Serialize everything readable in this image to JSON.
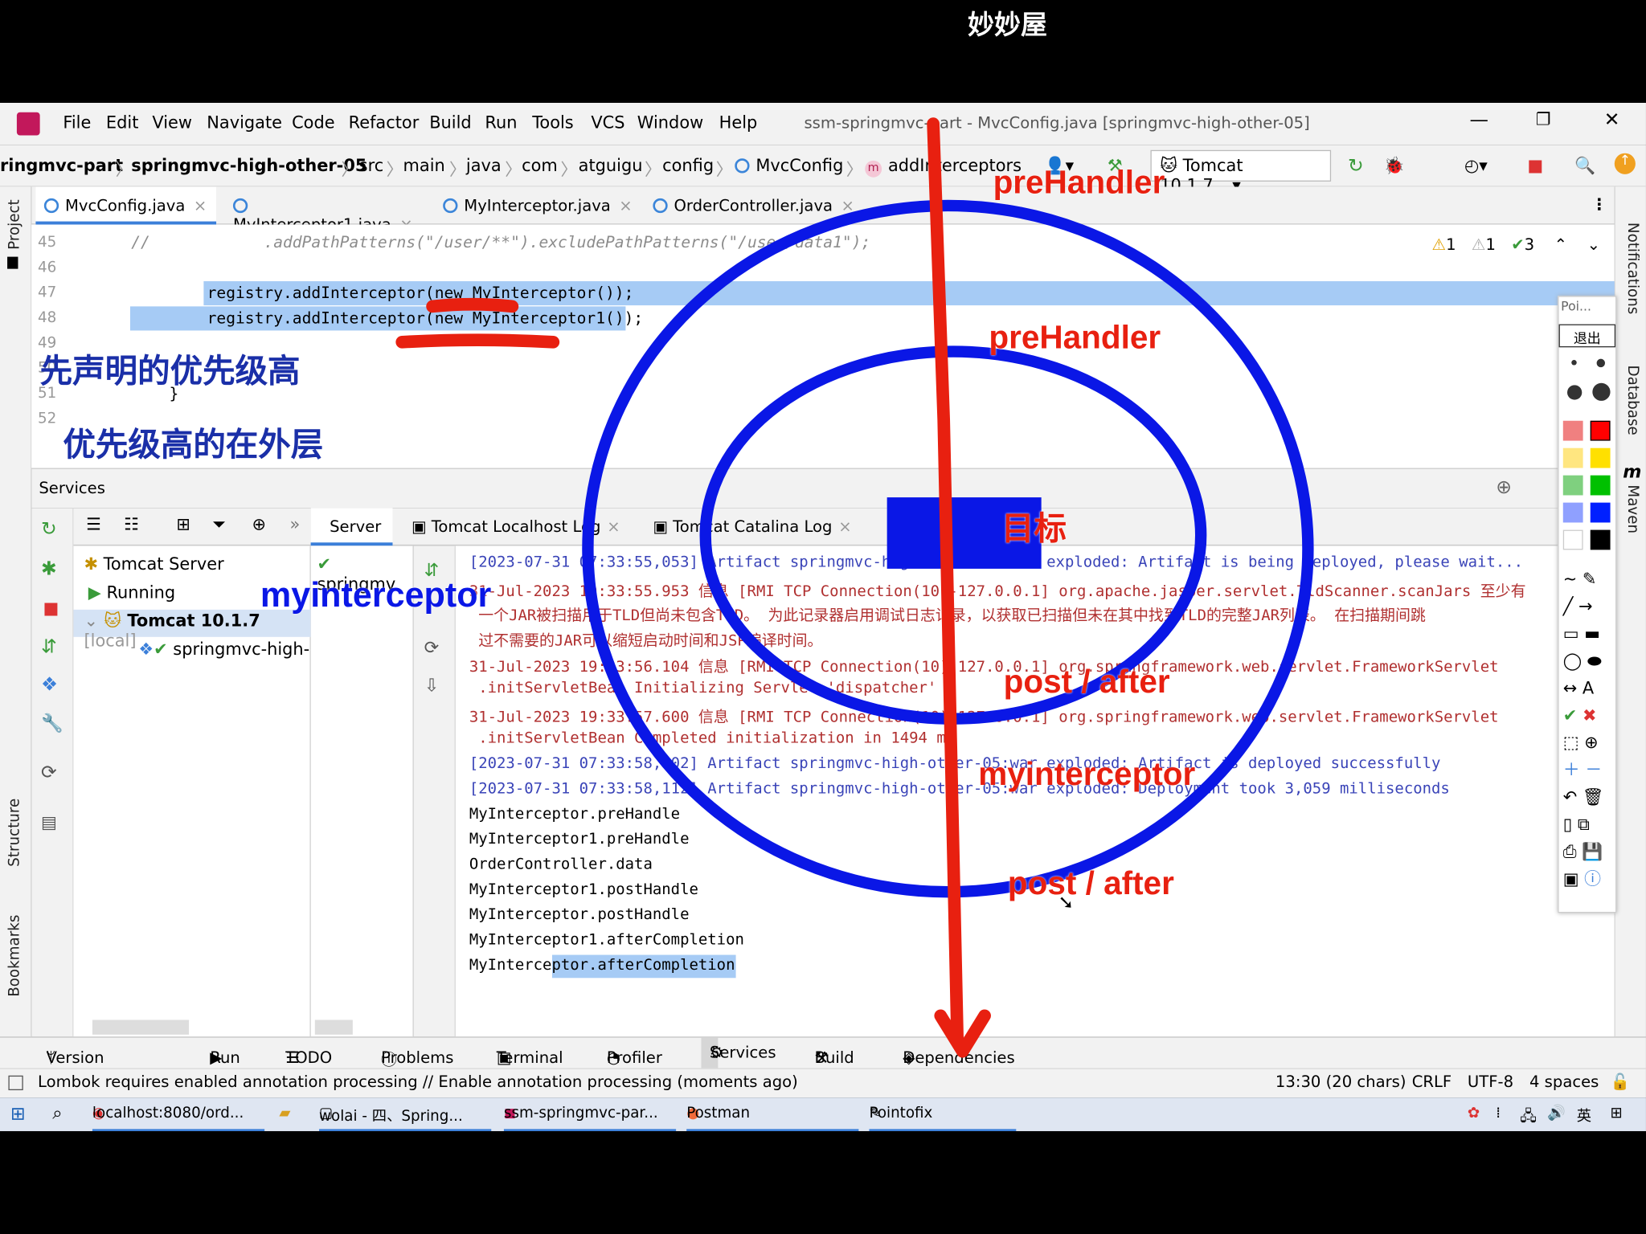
{
  "watermark": {
    "brand": "妙妙屋"
  },
  "window": {
    "title": "ssm-springmvc-part - MvcConfig.java [springmvc-high-other-05]"
  },
  "menu": [
    "File",
    "Edit",
    "View",
    "Navigate",
    "Code",
    "Refactor",
    "Build",
    "Run",
    "Tools",
    "VCS",
    "Window",
    "Help"
  ],
  "breadcrumb": [
    "ringmvc-part",
    "springmvc-high-other-05",
    "src",
    "main",
    "java",
    "com",
    "atguigu",
    "config",
    "MvcConfig",
    "addInterceptors"
  ],
  "run_config": "Tomcat 10.1.7",
  "left_tools": {
    "project": "Project",
    "structure": "Structure",
    "bookmarks": "Bookmarks"
  },
  "right_tools": {
    "notifications": "Notifications",
    "database": "Database",
    "maven": "Maven"
  },
  "editor_tabs": [
    "MvcConfig.java",
    "MyInterceptor1.java",
    "MyInterceptor.java",
    "OrderController.java"
  ],
  "inspection": {
    "warn": "1",
    "weak": "1",
    "ok": "3"
  },
  "code": {
    "lines": [
      "45",
      "46",
      "47",
      "48",
      "49",
      "50",
      "51",
      "52"
    ],
    "l45": "//            .addPathPatterns(\"/user/**\").excludePathPatterns(\"/user/data1\");",
    "l47": "        registry.addInterceptor(new MyInterceptor());",
    "l48": "        registry.addInterceptor(new MyInterceptor1());",
    "l51": "    }"
  },
  "services": {
    "title": "Services",
    "tree": {
      "root": "Tomcat Server",
      "running": "Running",
      "server": "Tomcat 10.1.7",
      "server_tag": "[local]",
      "deployment": "springmvc-high-"
    },
    "mid_item": "springmv",
    "tabs": [
      "Server",
      "Tomcat Localhost Log",
      "Tomcat Catalina Log"
    ]
  },
  "console": [
    "[2023-07-31 07:33:55,053] Artifact springmvc-high-other-05:war exploded: Artifact is being deployed, please wait...",
    "31-Jul-2023 19:33:55.953 信息 [RMI TCP Connection(10)-127.0.0.1] org.apache.jasper.servlet.TldScanner.scanJars 至少有",
    " 一个JAR被扫描用于TLD但尚未包含TLD。 为此记录器启用调试日志记录，以获取已扫描但未在其中找到TLD的完整JAR列表。 在扫描期间跳",
    " 过不需要的JAR可以缩短启动时间和JSP编译时间。",
    "31-Jul-2023 19:33:56.104 信息 [RMI TCP Connection(10)-127.0.0.1] org.springframework.web.servlet.FrameworkServlet",
    " .initServletBean Initializing Servlet 'dispatcher'",
    "31-Jul-2023 19:33:57.600 信息 [RMI TCP Connection(10)-127.0.0.1] org.springframework.web.servlet.FrameworkServlet",
    " .initServletBean Completed initialization in 1494 ms",
    "[2023-07-31 07:33:58,102] Artifact springmvc-high-other-05:war exploded: Artifact is deployed successfully",
    "[2023-07-31 07:33:58,112] Artifact springmvc-high-other-05:war exploded: Deployment took 3,059 milliseconds",
    "MyInterceptor.preHandle",
    "MyInterceptor1.preHandle",
    "OrderController.data",
    "MyInterceptor1.postHandle",
    "MyInterceptor.postHandle",
    "MyInterceptor1.afterCompletion",
    "MyInterceptor.afterCompletion"
  ],
  "bottom_tools": [
    "Version Control",
    "Run",
    "TODO",
    "Problems",
    "Terminal",
    "Profiler",
    "Services",
    "Build",
    "Dependencies"
  ],
  "status": {
    "message": "Lombok requires enabled annotation processing // Enable annotation processing (moments ago)",
    "position": "13:30 (20 chars)",
    "line_sep": "CRLF",
    "encoding": "UTF-8",
    "indent": "4 spaces"
  },
  "taskbar": [
    "localhost:8080/ord...",
    "wolai - 四、Spring...",
    "ssm-springmvc-par...",
    "Postman",
    "Pointofix"
  ],
  "tray_ime": "英",
  "pointofix": {
    "title": "Poi...",
    "exit": "退出"
  },
  "annotations": {
    "cn1": "先声明的优先级高",
    "cn2": "优先级高的在外层",
    "outer_pre": "preHandler",
    "inner_pre": "preHandler",
    "target": "目标",
    "inner_post": "post / after",
    "outer_post": "post / after",
    "label_outer_left": "myinterceptor",
    "label_inner_right": "myinterceptor"
  },
  "colors": {
    "annotation_red": "#e82010",
    "annotation_blue": "#0a17e6",
    "selection": "#a6cbf5",
    "accent": "#3b7fd9"
  }
}
